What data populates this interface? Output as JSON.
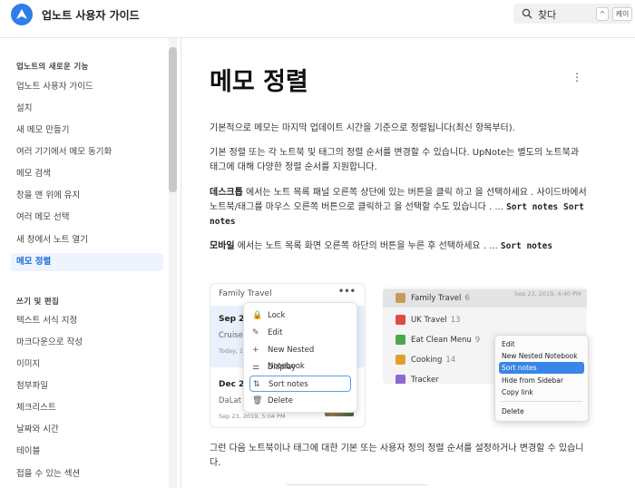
{
  "header": {
    "site_title": "업노트 사용자 가이드",
    "search_label": "찾다",
    "shortcut_1": "^",
    "shortcut_2": "케이"
  },
  "sidebar": {
    "section1_title": "업노트의 새로운 기능",
    "section1_items": [
      {
        "label": "업노트 사용자 가이드"
      },
      {
        "label": "설치"
      },
      {
        "label": "새 메모 만들기"
      },
      {
        "label": "여러 기기에서 메모 동기화"
      },
      {
        "label": "메모 검색"
      },
      {
        "label": "창을 맨 위에 유지"
      },
      {
        "label": "여러 메모 선택"
      },
      {
        "label": "새 창에서 노트 열기"
      },
      {
        "label": "메모 정렬",
        "active": true
      }
    ],
    "section2_title": "쓰기 및 편집",
    "section2_items": [
      {
        "label": "텍스트 서식 지정"
      },
      {
        "label": "마크다운으로 작성"
      },
      {
        "label": "이미지"
      },
      {
        "label": "첨부파일"
      },
      {
        "label": "체크리스트"
      },
      {
        "label": "날짜와 시간"
      },
      {
        "label": "테이블"
      },
      {
        "label": "접을 수 있는 섹션"
      }
    ]
  },
  "main": {
    "title": "메모 정렬",
    "p1": "기본적으로 메모는 마지막 업데이트 시간을 기준으로 정렬됩니다(최신 항목부터).",
    "p2": "기본 정렬 또는 각 노트북 및 태그의 정렬 순서를 변경할 수 있습니다. UpNote는 별도의 노트북과 태그에 대해 다양한 정렬 순서를 지원합니다.",
    "p3_bold": "데스크톱",
    "p3_rest": " 에서는 노트 목록 패널 오른쪽 상단에 있는 버튼을 클릭 하고 을 선택하세요 . 사이드바에서 노트북/태그를 마우스 오른쪽 버튼으로 클릭하고 을 선택할 수도 있습니다 . ...",
    "p3_code": "Sort notes Sort notes",
    "p4_bold": "모바일",
    "p4_rest": " 에서는 노트 목록 화면 오른쪽 하단의 버튼을 누른 후 선택하세요 . ...",
    "p4_code": "Sort notes",
    "p5": "그런 다음 노트북이나 태그에 대한 기본 또는 사용자 정의 정렬 순서를 설정하거나 변경할 수 있습니다."
  },
  "fig_left": {
    "notebook": "Family Travel",
    "dots": "•••",
    "note1_title": "Sep 20",
    "note1_snippet": "Cruise i",
    "note1_date": "Today, 10",
    "note2_title": "Dec 20",
    "note2_snippet": "DaLat",
    "note2_date": "Sep 23, 2019, 5:04 PM",
    "menu": [
      {
        "icon": "lock-icon",
        "glyph": "🔒",
        "label": "Lock"
      },
      {
        "icon": "pencil-icon",
        "glyph": "✎",
        "label": "Edit"
      },
      {
        "icon": "plus-icon",
        "glyph": "+",
        "label": "New Nested Notebook"
      },
      {
        "icon": "display-icon",
        "glyph": "⚌",
        "label": "Display"
      },
      {
        "icon": "sort-icon",
        "glyph": "⇅",
        "label": "Sort notes",
        "selected": true
      },
      {
        "icon": "trash-icon",
        "glyph": "🗑",
        "label": "Delete"
      }
    ]
  },
  "fig_right": {
    "date": "Sep 23, 2019, 4:40 PM",
    "rows": [
      {
        "label": "Family Travel",
        "count": "6",
        "color": "#c89a5a"
      },
      {
        "label": "UK Travel",
        "count": "13",
        "color": "#e04a4a"
      },
      {
        "label": "Eat Clean Menu",
        "count": "9",
        "color": "#4aa84a"
      },
      {
        "label": "Cooking",
        "count": "14",
        "color": "#e0a030"
      },
      {
        "label": "Tracker",
        "count": "",
        "color": "#8a6ad0"
      }
    ],
    "menu": [
      "Edit",
      "New Nested Notebook",
      "Sort notes",
      "Hide from Sidebar",
      "Copy link",
      "Delete"
    ]
  }
}
